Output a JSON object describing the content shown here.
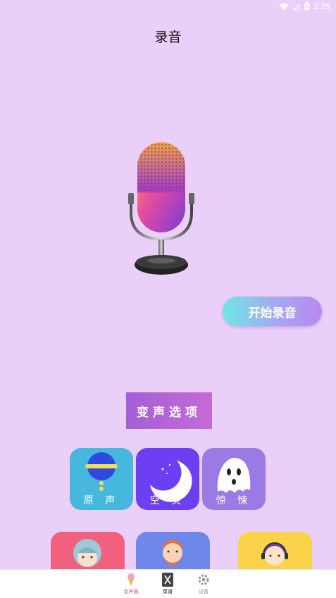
{
  "status": {
    "time": "2:28"
  },
  "header": {
    "title": "录音"
  },
  "actions": {
    "record_label": "开始录音",
    "options_label": "变声选项"
  },
  "effects": [
    {
      "label": "原 声",
      "color": "#46b8dd"
    },
    {
      "label": "空 灵",
      "color": "#6c3ff2"
    },
    {
      "label": "惊 悚",
      "color": "#9a7be6"
    }
  ],
  "more_effects": [
    {
      "color": "#f1607d"
    },
    {
      "color": "#6e87e8"
    },
    {
      "color": "#fbd34b"
    }
  ],
  "tabbar": {
    "items": [
      {
        "label": "变声器",
        "active": true,
        "color": "#e84fa8"
      },
      {
        "label": "菜谱",
        "active": false,
        "color": "#222222"
      },
      {
        "label": "设置",
        "active": false,
        "color": "#999999"
      }
    ]
  },
  "colors": {
    "background": "#ead0f8",
    "accent": "#e84fa8"
  }
}
